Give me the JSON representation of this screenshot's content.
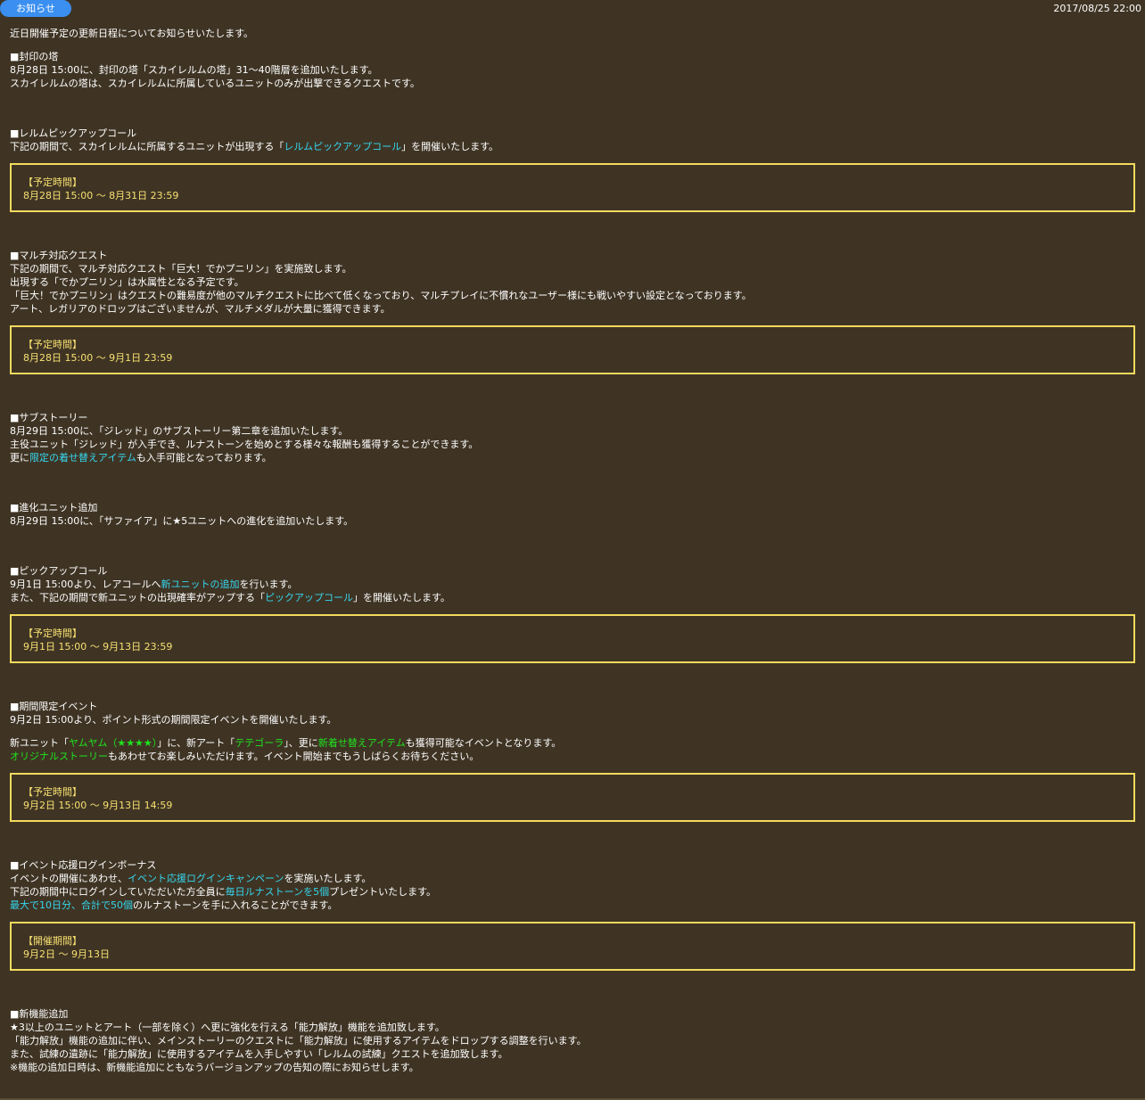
{
  "header": {
    "tab_label": "お知らせ",
    "date": "2017/08/25 22:00"
  },
  "intro": "近日開催予定の更新日程についてお知らせいたします。",
  "s1": {
    "title": "■封印の塔",
    "l1": "8月28日 15:00に、封印の塔「スカイレルムの塔」31～40階層を追加いたします。",
    "l2": "スカイレルムの塔は、スカイレルムに所属しているユニットのみが出撃できるクエストです。"
  },
  "s2": {
    "title": "■レルムピックアップコール",
    "l1a": "下記の期間で、スカイレルムに所属するユニットが出現する「",
    "l1b": "レルムピックアップコール",
    "l1c": "」を開催いたします。",
    "box_title": "【予定時間】",
    "box_value": "8月28日 15:00 ～ 8月31日 23:59"
  },
  "s3": {
    "title": "■マルチ対応クエスト",
    "l1": "下記の期間で、マルチ対応クエスト「巨大！でかプニリン」を実施致します。",
    "l2": "出現する「でかプニリン」は水属性となる予定です。",
    "l3": "「巨大！でかプニリン」はクエストの難易度が他のマルチクエストに比べて低くなっており、マルチプレイに不慣れなユーザー様にも戦いやすい設定となっております。",
    "l4": "アート、レガリアのドロップはございませんが、マルチメダルが大量に獲得できます。",
    "box_title": "【予定時間】",
    "box_value": "8月28日 15:00 ～ 9月1日 23:59"
  },
  "s4": {
    "title": "■サブストーリー",
    "l1": "8月29日 15:00に、「ジレッド」のサブストーリー第二章を追加いたします。",
    "l2": "主役ユニット「ジレッド」が入手でき、ルナストーンを始めとする様々な報酬も獲得することができます。",
    "l3a": "更に",
    "l3b": "限定の着せ替えアイテム",
    "l3c": "も入手可能となっております。"
  },
  "s5": {
    "title": "■進化ユニット追加",
    "l1": "8月29日 15:00に、「サファイア」に★5ユニットへの進化を追加いたします。"
  },
  "s6": {
    "title": "■ピックアップコール",
    "l1a": "9月1日 15:00より、レアコールへ",
    "l1b": "新ユニットの追加",
    "l1c": "を行います。",
    "l2a": "また、下記の期間で新ユニットの出現確率がアップする「",
    "l2b": "ピックアップコール",
    "l2c": "」を開催いたします。",
    "box_title": "【予定時間】",
    "box_value": "9月1日 15:00 ～ 9月13日 23:59"
  },
  "s7": {
    "title": "■期間限定イベント",
    "l1": "9月2日 15:00より、ポイント形式の期間限定イベントを開催いたします。",
    "l2a": "新ユニット「",
    "l2b": "ヤムヤム（★★★★）",
    "l2c": "」に、新アート「",
    "l2d": "テテゴーラ",
    "l2e": "」、更に",
    "l2f": "新着せ替えアイテム",
    "l2g": "も獲得可能なイベントとなります。",
    "l3a": "オリジナルストーリー",
    "l3b": "もあわせてお楽しみいただけます。イベント開始までもうしばらくお待ちください。",
    "box_title": "【予定時間】",
    "box_value": "9月2日 15:00 ～ 9月13日 14:59"
  },
  "s8": {
    "title": "■イベント応援ログインボーナス",
    "l1a": "イベントの開催にあわせ、",
    "l1b": "イベント応援ログインキャンペーン",
    "l1c": "を実施いたします。",
    "l2a": "下記の期間中にログインしていただいた方全員に",
    "l2b": "毎日ルナストーンを5個",
    "l2c": "プレゼントいたします。",
    "l3a": "最大で10日分、合計で50個",
    "l3b": "のルナストーンを手に入れることができます。",
    "box_title": "【開催期間】",
    "box_value": "9月2日 ～ 9月13日"
  },
  "s9": {
    "title": "■新機能追加",
    "l1": "★3以上のユニットとアート（一部を除く）へ更に強化を行える「能力解放」機能を追加致します。",
    "l2": "「能力解放」機能の追加に伴い、メインストーリーのクエストに「能力解放」に使用するアイテムをドロップする調整を行います。",
    "l3": "また、試練の遺跡に「能力解放」に使用するアイテムを入手しやすい「レルムの試練」クエストを追加致します。",
    "l4": "※機能の追加日時は、新機能追加にともなうバージョンアップの告知の際にお知らせします。"
  },
  "colors": {
    "background": "#3f3424",
    "tab": "#3a8ff0",
    "box_border": "#f2da5e",
    "box_text": "#f7e070",
    "link_cyan": "#35d6ee",
    "link_green": "#1ee31e"
  }
}
